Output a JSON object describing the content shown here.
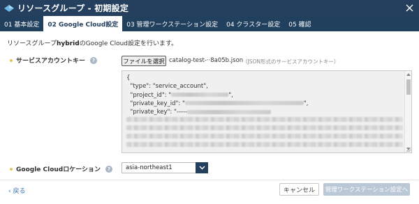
{
  "window": {
    "title": "リソースグループ - 初期設定",
    "logo_icon": "app-logo-icon",
    "close_icon": "close-icon"
  },
  "tabs": [
    {
      "label": "01 基本設定",
      "active": false
    },
    {
      "label": "02 Google Cloud設定",
      "active": true
    },
    {
      "label": "03 管理ワークステーション設定",
      "active": false
    },
    {
      "label": "04 クラスター設定",
      "active": false
    },
    {
      "label": "05 確認",
      "active": false
    }
  ],
  "intro": {
    "prefix": "リソースグループ",
    "group_name": "hybrid",
    "suffix": "のGoogle Cloud設定を行います。"
  },
  "service_account": {
    "label": "サービスアカウントキー",
    "file_button": "ファイルを選択",
    "file_name": "catalog-test-··8a05b.json",
    "hint": "（JSON形式のサービスアカウントキー）",
    "json_lines": [
      "{",
      "  \"type\": \"service_account\",",
      "  \"project_id\": \"",
      "  \"private_key_id\": \"",
      "  \"private_key\": \"-----"
    ],
    "line_endings": [
      "",
      "",
      "\",",
      "\",",
      ""
    ]
  },
  "location": {
    "label": "Google Cloudロケーション",
    "selected": "asia-northeast1"
  },
  "footer": {
    "back": "戻る",
    "cancel": "キャンセル",
    "next": "管理ワークステーション設定へ"
  },
  "colors": {
    "header_bg": "#24405e",
    "tab_bg": "#20405e",
    "required_dot": "#e6c15a",
    "link": "#2f6fb3",
    "next_button_disabled": "#b9c7d6"
  }
}
